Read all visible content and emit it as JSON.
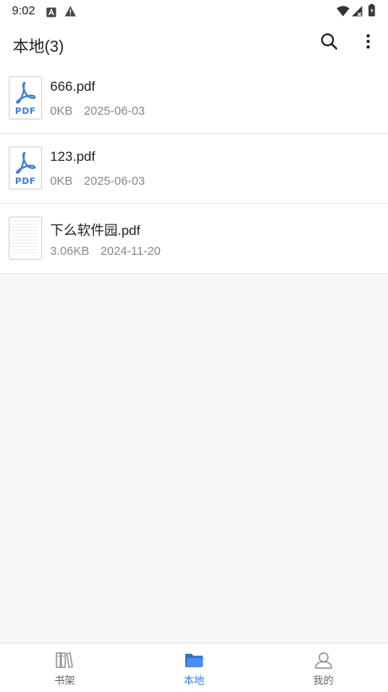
{
  "status_bar": {
    "time": "9:02",
    "icons": [
      "a-notification-icon",
      "warning-icon",
      "wifi-icon",
      "signal-icon",
      "battery-icon"
    ]
  },
  "app_bar": {
    "title": "本地(3)",
    "actions": [
      "search-icon",
      "more-vert-icon"
    ]
  },
  "files": [
    {
      "name": "666.pdf",
      "size": "0KB",
      "date": "2025-06-03",
      "thumb": "pdf-icon",
      "thumb_label": "PDF"
    },
    {
      "name": "123.pdf",
      "size": "0KB",
      "date": "2025-06-03",
      "thumb": "pdf-icon",
      "thumb_label": "PDF"
    },
    {
      "name": "下么软件园.pdf",
      "size": "3.06KB",
      "date": "2024-11-20",
      "thumb": "document-preview"
    }
  ],
  "bottom_nav": {
    "items": [
      {
        "label": "书架",
        "icon": "bookshelf-icon",
        "active": false
      },
      {
        "label": "本地",
        "icon": "folder-icon",
        "active": true
      },
      {
        "label": "我的",
        "icon": "person-icon",
        "active": false
      }
    ]
  },
  "colors": {
    "accent": "#3a7ddc",
    "pdf_icon": "#3f7fd6",
    "text_primary": "#222222",
    "text_secondary": "#888888",
    "background": "#f7f7f7"
  }
}
